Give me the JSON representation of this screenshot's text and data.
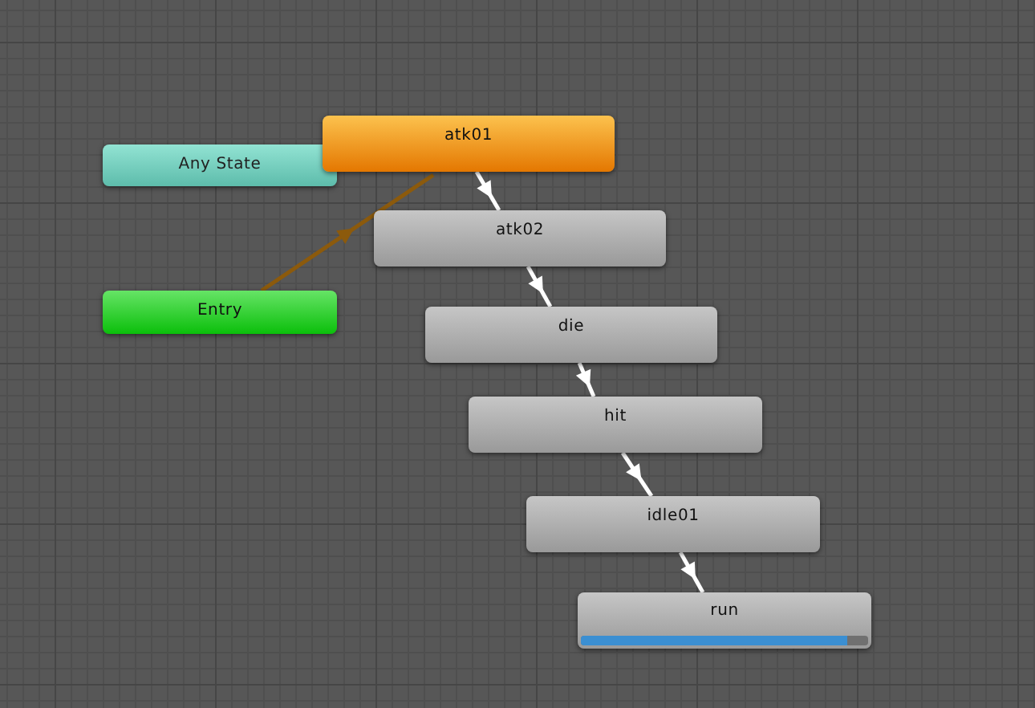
{
  "nodes": [
    {
      "label": "Any State",
      "kind": "any_state"
    },
    {
      "label": "Entry",
      "kind": "entry",
      "default_transition": true
    },
    {
      "label": "atk01",
      "kind": "default",
      "transition_to_next": true
    },
    {
      "label": "atk02",
      "kind": "state",
      "transition_to_next": true
    },
    {
      "label": "die",
      "kind": "state",
      "transition_to_next": true
    },
    {
      "label": "hit",
      "kind": "state",
      "transition_to_next": true
    },
    {
      "label": "idle01",
      "kind": "state",
      "transition_to_next": true
    },
    {
      "label": "run",
      "kind": "state",
      "transition_to_next": false,
      "level": 0.93
    }
  ]
}
